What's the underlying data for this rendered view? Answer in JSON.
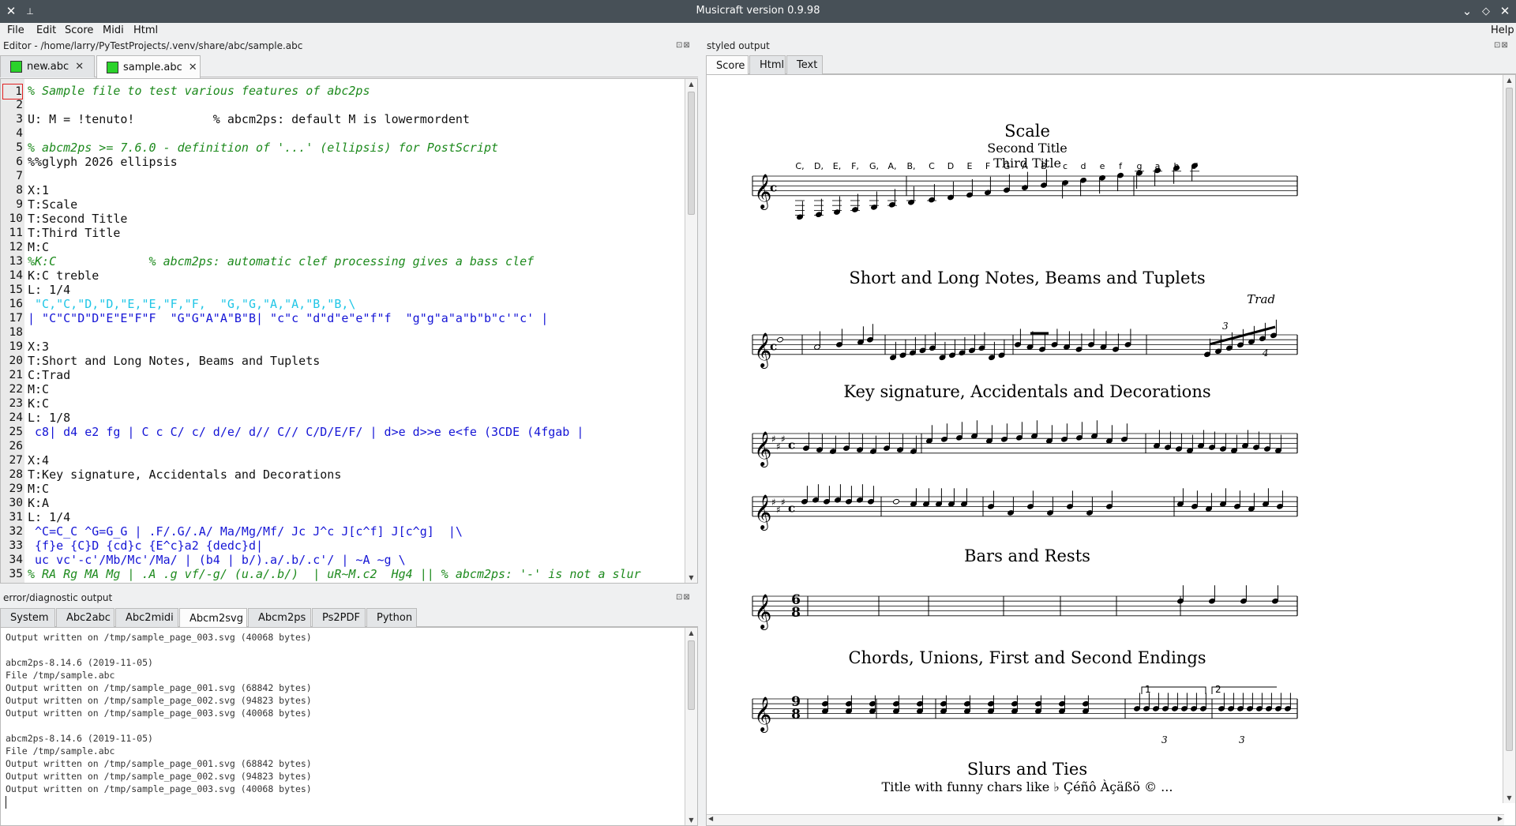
{
  "window": {
    "title": "Musicraft version 0.9.98",
    "close_glyph": "✕",
    "pin_glyph": "📌",
    "minimize_glyph": "⌄",
    "maximize_glyph": "◇",
    "close_right_glyph": "✕"
  },
  "menu": {
    "file": "File",
    "edit": "Edit",
    "score": "Score",
    "midi": "Midi",
    "html": "Html",
    "help": "Help"
  },
  "editor": {
    "panel_title": "Editor - /home/larry/PyTestProjects/.venv/share/abc/sample.abc",
    "dock_buttons": "⊡⊠",
    "tabs": [
      {
        "label": "new.abc",
        "close": "✕"
      },
      {
        "label": "sample.abc",
        "close": "✕"
      }
    ],
    "lines": [
      {
        "n": "1",
        "t": "% Sample file to test various features of abc2ps",
        "s": "comment"
      },
      {
        "n": "2",
        "t": "",
        "s": "default"
      },
      {
        "n": "3",
        "t": "U: M = !tenuto!           % abcm2ps: default M is lowermordent",
        "s": "default"
      },
      {
        "n": "4",
        "t": "",
        "s": "default"
      },
      {
        "n": "5",
        "t": "% abcm2ps >= 7.6.0 - definition of '...' (ellipsis) for PostScript",
        "s": "comment"
      },
      {
        "n": "6",
        "t": "%%glyph 2026 ellipsis",
        "s": "default"
      },
      {
        "n": "7",
        "t": "",
        "s": "default"
      },
      {
        "n": "8",
        "t": "X:1",
        "s": "default"
      },
      {
        "n": "9",
        "t": "T:Scale",
        "s": "default"
      },
      {
        "n": "10",
        "t": "T:Second Title",
        "s": "default"
      },
      {
        "n": "11",
        "t": "T:Third Title",
        "s": "default"
      },
      {
        "n": "12",
        "t": "M:C",
        "s": "default"
      },
      {
        "n": "13",
        "t": "%K:C             % abcm2ps: automatic clef processing gives a bass clef",
        "s": "comment"
      },
      {
        "n": "14",
        "t": "K:C treble",
        "s": "default"
      },
      {
        "n": "15",
        "t": "L: 1/4",
        "s": "default"
      },
      {
        "n": "16",
        "t": " \"C,\"C,\"D,\"D,\"E,\"E,\"F,\"F,  \"G,\"G,\"A,\"A,\"B,\"B,\\",
        "s": "cyan"
      },
      {
        "n": "17",
        "t": "| \"C\"C\"D\"D\"E\"E\"F\"F  \"G\"G\"A\"A\"B\"B| \"c\"c \"d\"d\"e\"e\"f\"f  \"g\"g\"a\"a\"b\"b\"c'\"c' |",
        "s": "blue"
      },
      {
        "n": "18",
        "t": "",
        "s": "default"
      },
      {
        "n": "19",
        "t": "X:3",
        "s": "default"
      },
      {
        "n": "20",
        "t": "T:Short and Long Notes, Beams and Tuplets",
        "s": "default"
      },
      {
        "n": "21",
        "t": "C:Trad",
        "s": "default"
      },
      {
        "n": "22",
        "t": "M:C",
        "s": "default"
      },
      {
        "n": "23",
        "t": "K:C",
        "s": "default"
      },
      {
        "n": "24",
        "t": "L: 1/8",
        "s": "default"
      },
      {
        "n": "25",
        "t": " c8| d4 e2 fg | C c C/ c/ d/e/ d// C// C/D/E/F/ | d>e d>>e e<fe (3CDE (4fgab |",
        "s": "blue"
      },
      {
        "n": "26",
        "t": "",
        "s": "default"
      },
      {
        "n": "27",
        "t": "X:4",
        "s": "default"
      },
      {
        "n": "28",
        "t": "T:Key signature, Accidentals and Decorations",
        "s": "default"
      },
      {
        "n": "29",
        "t": "M:C",
        "s": "default"
      },
      {
        "n": "30",
        "t": "K:A",
        "s": "default"
      },
      {
        "n": "31",
        "t": "L: 1/4",
        "s": "default"
      },
      {
        "n": "32",
        "t": " ^C=C_C ^G=G_G | .F/.G/.A/ Ma/Mg/Mf/ Jc J^c J[c^f] J[c^g]  |\\",
        "s": "blue"
      },
      {
        "n": "33",
        "t": " {f}e {C}D {cd}c {E^c}a2 {dedc}d|",
        "s": "blue"
      },
      {
        "n": "34",
        "t": " uc vc'-c'/Mb/Mc'/Ma/ | (b4 | b/).a/.b/.c'/ | ~A ~g \\",
        "s": "blue"
      },
      {
        "n": "35",
        "t": "% RA Rg MA Mg | .A .g vf/-g/ (u.a/.b/)  | uR~M.c2  Hg4 || % abcm2ps: '-' is not a slur",
        "s": "comment"
      }
    ]
  },
  "error_panel": {
    "title": "error/diagnostic output",
    "dock_buttons": "⊡⊠",
    "tabs": [
      "System",
      "Abc2abc",
      "Abc2midi",
      "Abcm2svg",
      "Abcm2ps",
      "Ps2PDF",
      "Python"
    ],
    "active_tab": "Abcm2svg",
    "lines": [
      "Output written on /tmp/sample_page_003.svg (40068 bytes)",
      "",
      "abcm2ps-8.14.6 (2019-11-05)",
      "File /tmp/sample.abc",
      "Output written on /tmp/sample_page_001.svg (68842 bytes)",
      "Output written on /tmp/sample_page_002.svg (94823 bytes)",
      "Output written on /tmp/sample_page_003.svg (40068 bytes)",
      "",
      "abcm2ps-8.14.6 (2019-11-05)",
      "File /tmp/sample.abc",
      "Output written on /tmp/sample_page_001.svg (68842 bytes)",
      "Output written on /tmp/sample_page_002.svg (94823 bytes)",
      "Output written on /tmp/sample_page_003.svg (40068 bytes)"
    ]
  },
  "styled_output": {
    "title": "styled output",
    "dock_buttons": "⊡⊠",
    "tabs": [
      "Score",
      "Html",
      "Text"
    ],
    "active_tab": "Score",
    "score": {
      "tune1": {
        "title": "Scale",
        "subtitle1": "Second Title",
        "subtitle2": "Third Title",
        "chord_names": [
          "C,",
          "D,",
          "E,",
          "F,",
          "G,",
          "A,",
          "B,",
          "C",
          "D",
          "E",
          "F",
          "G",
          "A",
          "B",
          "c",
          "d",
          "e",
          "f",
          "g",
          "a",
          "b",
          "c'"
        ]
      },
      "tune3": {
        "title": "Short and Long Notes, Beams and Tuplets",
        "composer": "Trad",
        "tuplet3": "3",
        "tuplet4": "4"
      },
      "tune4": {
        "title": "Key signature, Accidentals and Decorations"
      },
      "tune5": {
        "title": "Bars and Rests",
        "time_top": "6",
        "time_bottom": "8"
      },
      "tune6": {
        "title": "Chords, Unions, First and Second Endings",
        "ending1": "1",
        "ending2": "2",
        "tuplet": "3",
        "time_top": "9",
        "time_bottom": "8"
      },
      "tune7": {
        "title": "Slurs and Ties",
        "subtitle": "Title with funny chars like ♭ Çéñô Àçäßö © ..."
      },
      "clef_glyph": "𝄞",
      "common_time": "c"
    }
  }
}
